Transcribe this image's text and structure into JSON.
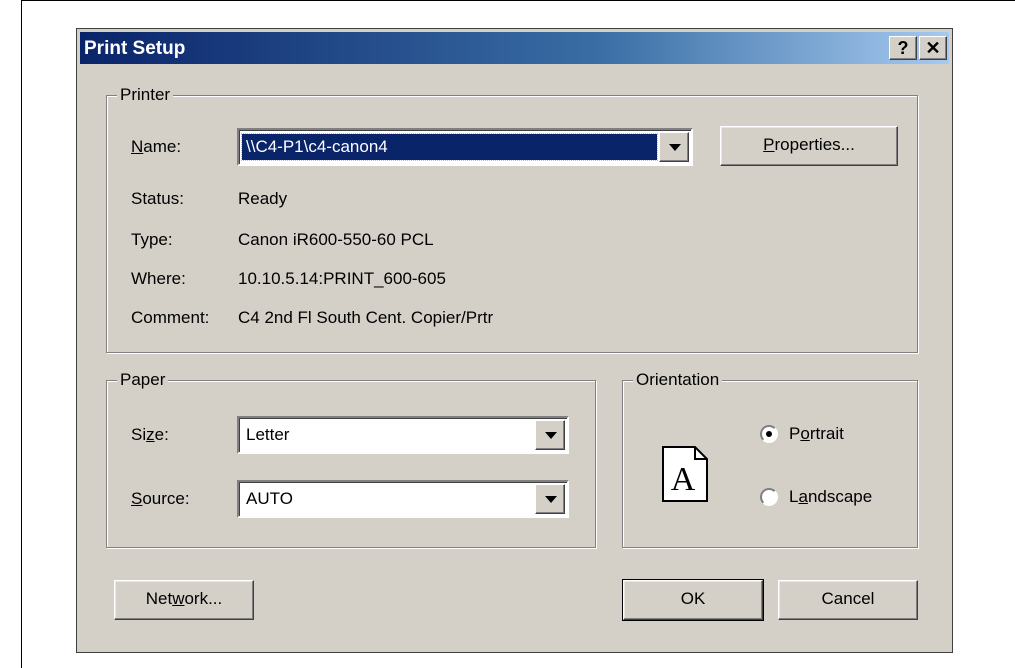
{
  "dialog": {
    "title": "Print Setup",
    "help_button": "?",
    "close_button": "✕"
  },
  "printer": {
    "group_label": "Printer",
    "name_label_pre": "",
    "name_label_u": "N",
    "name_label_post": "ame:",
    "name_value": "\\\\C4-P1\\c4-canon4",
    "properties_u": "P",
    "properties_post": "roperties...",
    "status_label": "Status:",
    "status_value": "Ready",
    "type_label": "Type:",
    "type_value": "Canon iR600-550-60 PCL",
    "where_label": "Where:",
    "where_value": "10.10.5.14:PRINT_600-605",
    "comment_label": "Comment:",
    "comment_value": "C4 2nd Fl South Cent. Copier/Prtr"
  },
  "paper": {
    "group_label": "Paper",
    "size_label_pre": "Si",
    "size_label_u": "z",
    "size_label_post": "e:",
    "size_value": "Letter",
    "source_label_u": "S",
    "source_label_post": "ource:",
    "source_value": "AUTO"
  },
  "orientation": {
    "group_label": "Orientation",
    "icon_letter": "A",
    "portrait_pre": "P",
    "portrait_u": "o",
    "portrait_post": "rtrait",
    "portrait_selected": true,
    "landscape_pre": "L",
    "landscape_u": "a",
    "landscape_post": "ndscape",
    "landscape_selected": false
  },
  "buttons": {
    "network_pre": "Net",
    "network_u": "w",
    "network_post": "ork...",
    "ok": "OK",
    "cancel": "Cancel"
  },
  "colors": {
    "face": "#d4d0c8",
    "title_start": "#0a246a",
    "title_end": "#a6caf0",
    "selection": "#0a246a"
  }
}
